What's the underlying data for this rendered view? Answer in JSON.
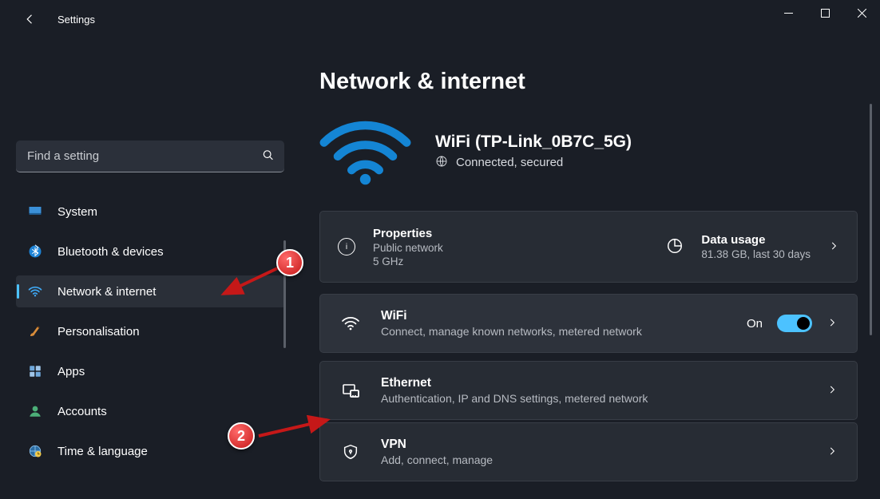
{
  "window": {
    "title": "Settings"
  },
  "search": {
    "placeholder": "Find a setting"
  },
  "sidebar": {
    "items": [
      {
        "label": "System"
      },
      {
        "label": "Bluetooth & devices"
      },
      {
        "label": "Network & internet"
      },
      {
        "label": "Personalisation"
      },
      {
        "label": "Apps"
      },
      {
        "label": "Accounts"
      },
      {
        "label": "Time & language"
      }
    ],
    "selected_index": 2
  },
  "page": {
    "title": "Network & internet",
    "connection": {
      "name": "WiFi (TP-Link_0B7C_5G)",
      "status": "Connected, secured"
    },
    "properties": {
      "label": "Properties",
      "line1": "Public network",
      "line2": "5 GHz"
    },
    "data_usage": {
      "label": "Data usage",
      "detail": "81.38 GB, last 30 days"
    },
    "rows": {
      "wifi": {
        "title": "WiFi",
        "detail": "Connect, manage known networks, metered network",
        "state_label": "On",
        "on": true
      },
      "ethernet": {
        "title": "Ethernet",
        "detail": "Authentication, IP and DNS settings, metered network"
      },
      "vpn": {
        "title": "VPN",
        "detail": "Add, connect, manage"
      }
    }
  },
  "annotations": {
    "badge1": "1",
    "badge2": "2"
  },
  "colors": {
    "accent": "#4cc2ff"
  }
}
